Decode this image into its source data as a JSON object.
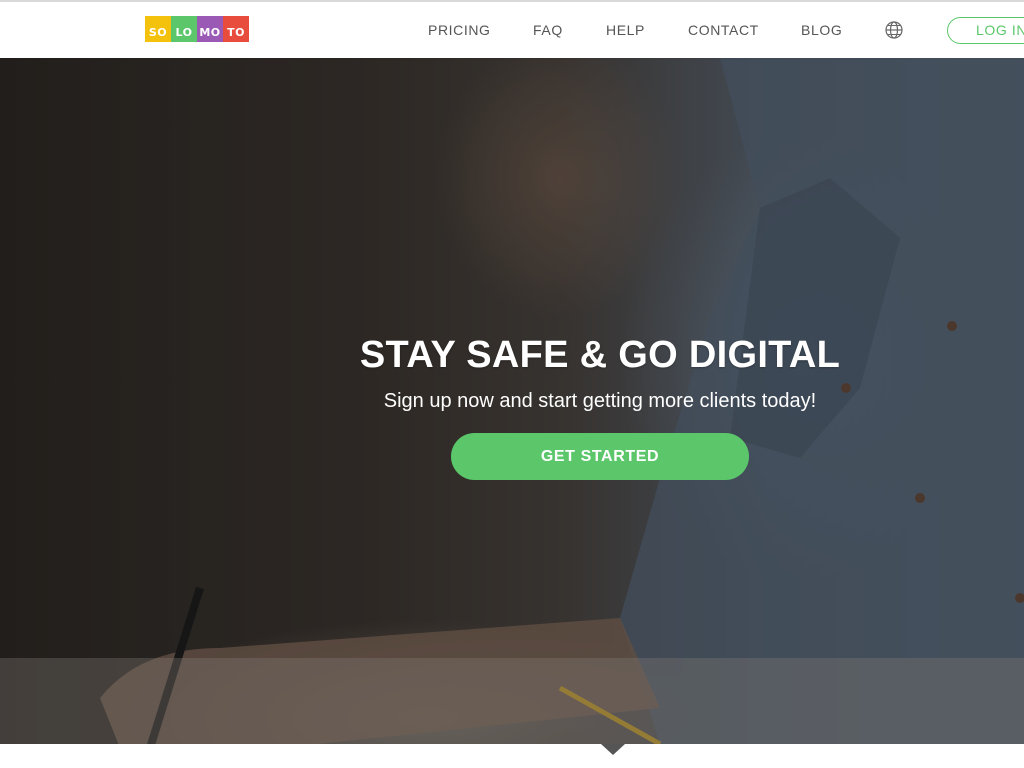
{
  "logo": {
    "blocks": [
      {
        "text": "SO",
        "color": "#f4c20d"
      },
      {
        "text": "LO",
        "color": "#5bc76a"
      },
      {
        "text": "MO",
        "color": "#9b59b6"
      },
      {
        "text": "TO",
        "color": "#e74c3c"
      }
    ]
  },
  "nav": {
    "items": [
      "PRICING",
      "FAQ",
      "HELP",
      "CONTACT",
      "BLOG"
    ],
    "language_icon": "globe-icon",
    "login_label": "LOG IN"
  },
  "hero": {
    "headline": "STAY SAFE & GO DIGITAL",
    "subline": "Sign up now and start getting more clients today!",
    "cta_label": "GET STARTED"
  },
  "colors": {
    "accent": "#5bc76a",
    "nav_text": "#555555"
  }
}
